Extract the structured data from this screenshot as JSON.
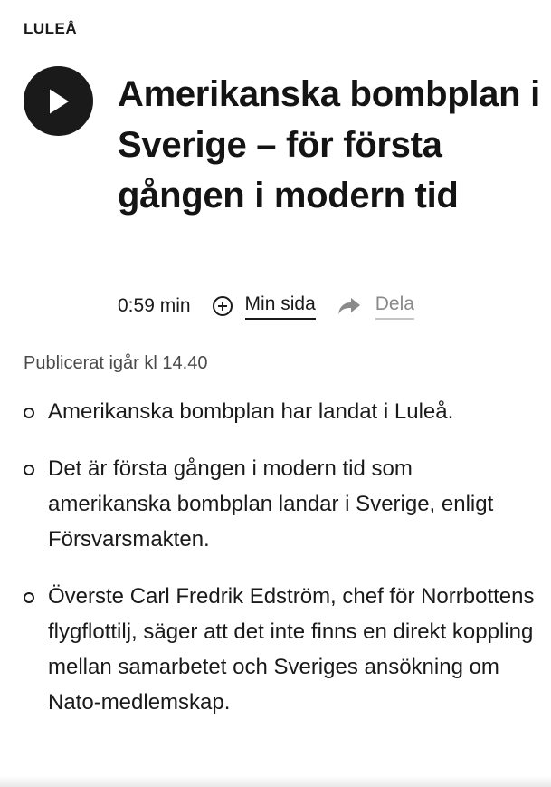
{
  "article": {
    "category": "LULEÅ",
    "headline": "Amerikanska bombplan i Sverige – för första gången i modern tid",
    "published": "Publicerat igår kl 14.40",
    "bullets": [
      "Amerikanska bombplan har landat i Luleå.",
      "Det är första gången i modern tid som amerikanska bombplan landar i Sverige, enligt Försvarsmakten.",
      "Överste Carl Fredrik Edström, chef för Norrbottens flygflottilj, säger att det inte finns en direkt koppling mellan samarbetet och Sveriges ansökning om Nato-medlemskap."
    ]
  },
  "audio": {
    "duration": "0:59 min",
    "play_icon": "play-icon"
  },
  "actions": {
    "mysida_label": "Min sida",
    "mysida_icon": "plus-circle-icon",
    "share_label": "Dela",
    "share_icon": "share-arrow-icon"
  },
  "colors": {
    "text": "#1a1a1a",
    "muted": "#8a8a8a",
    "published": "#4a4a4a",
    "background": "#ffffff"
  }
}
